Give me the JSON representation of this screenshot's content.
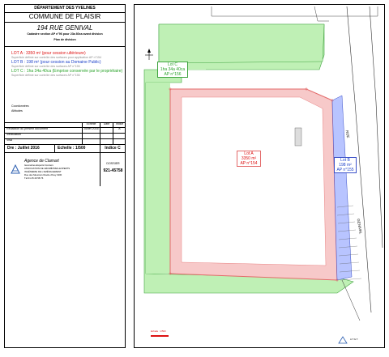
{
  "title_block": {
    "department": "DÉPARTEMENT DES YVELINES",
    "commune": "COMMUNE DE PLAISIR",
    "address": "194 RUE GENIVAL",
    "cadastre": "Cadastre section AP n°96 pour 23a 80ca avant division",
    "plan_title": "Plan de division",
    "lots": [
      {
        "name": "LOT A",
        "text": "LOT A : 3350 m² (pour cession ultérieure)",
        "sub": "Superficie définie sur contrôle des surfaces pour application AP n°154"
      },
      {
        "name": "LOT B",
        "text": "LOT B : 198 m² (pour cession au Domaine Public)",
        "sub": "Superficie définie sur contrôle des surfaces AP n°155"
      },
      {
        "name": "LOT C",
        "text": "LOT C : 1ha 34a 40ca (Emprise conservée par le propriétaire)",
        "sub": "Superficie définie sur contrôle des surfaces AP n°156"
      }
    ],
    "legend_lines": [
      "Coordonnées",
      "Altitudes"
    ],
    "table_head": [
      "Echelle",
      "Date",
      "Indice"
    ],
    "table_rows": [
      [
        "Rédaction du présent document",
        "Juillet 2016",
        "A"
      ],
      [
        "Vérification",
        "",
        ""
      ],
      [
        "Visa",
        "",
        ""
      ]
    ],
    "date_label": "Dre : Juillet 2016",
    "scale_label": "Echelle : 1/500",
    "index_label": "Indice C",
    "office_name": "Agence de Clamart",
    "office_lines": [
      "Géomètres-Experts Fonciers",
      "ASSOCIATION DE GÉOMÈTRES-EXPERTS",
      "INGÉNIERIE DE L'AMÉNAGEMENT",
      "Rue des Meuniers Ruelle d'Issy 1900",
      "Tél 01 45 29 58 76"
    ],
    "dossier_label": "DOSSIER",
    "dossier_number": "921-45758"
  },
  "plan": {
    "lot_a": {
      "name": "Lot A",
      "area": "3350 m²",
      "ref": "AP n°154"
    },
    "lot_b": {
      "name": "Lot B",
      "area": "198 m²",
      "ref": "AP n°155"
    },
    "lot_c": {
      "name": "Lot C",
      "area": "1ha 34a 40ca",
      "ref": "AP n°156"
    },
    "street_name": "RUE",
    "street_name2": "GENIVAL",
    "scale_bar": "Echelle : 1/500",
    "footer_code": "A.T.G.T.",
    "colors": {
      "lot_a": "#f7c9c9",
      "lot_a_border": "#e36a6a",
      "lot_b": "#b8c4ff",
      "lot_c": "#bff0b5"
    }
  }
}
